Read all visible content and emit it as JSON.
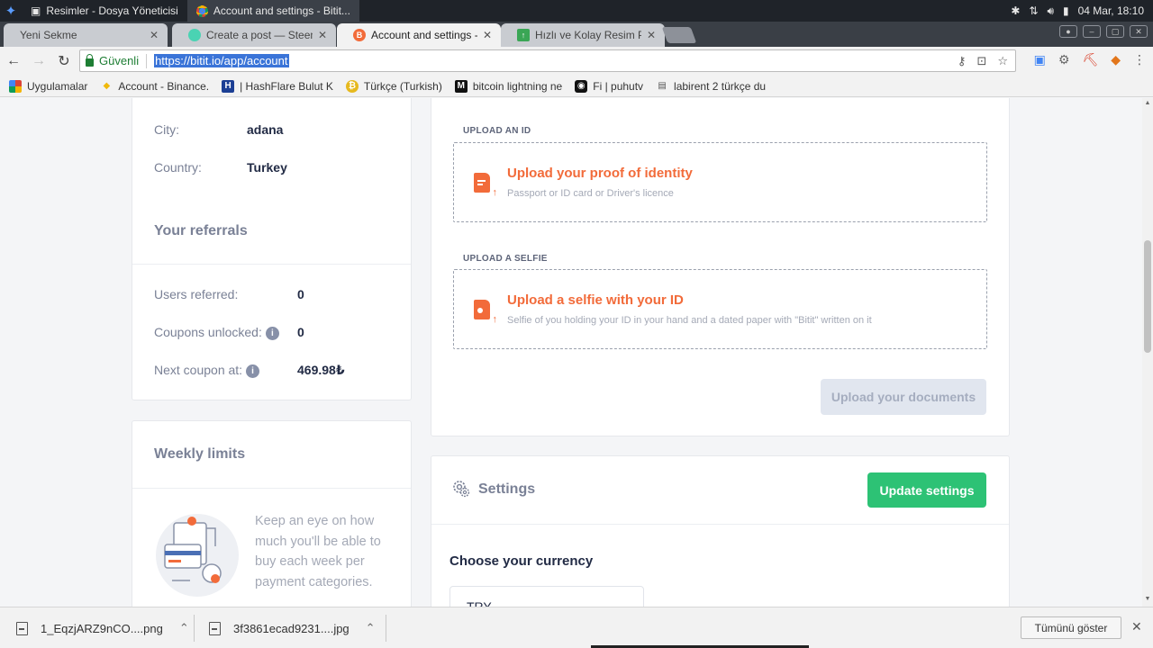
{
  "os": {
    "tasks": [
      {
        "label": "Resimler - Dosya Yöneticisi"
      },
      {
        "label": "Account and settings - Bitit..."
      }
    ],
    "clock": "04 Mar, 18:10"
  },
  "browser": {
    "tabs": [
      {
        "title": "Yeni Sekme"
      },
      {
        "title": "Create a post — Steem"
      },
      {
        "title": "Account and settings -"
      },
      {
        "title": "Hızlı ve Kolay Resim Pa"
      }
    ],
    "secure_label": "Güvenli",
    "url": "https://bitit.io/app/account",
    "bookmarks": [
      {
        "label": "Uygulamalar"
      },
      {
        "label": "Account - Binance."
      },
      {
        "label": "| HashFlare Bulut K"
      },
      {
        "label": "Türkçe (Turkish)"
      },
      {
        "label": "bitcoin lightning ne"
      },
      {
        "label": "Fi | puhutv"
      },
      {
        "label": "labirent 2 türkçe du"
      }
    ]
  },
  "profile": {
    "city_label": "City:",
    "city_value": "adana",
    "country_label": "Country:",
    "country_value": "Turkey"
  },
  "referrals": {
    "title": "Your referrals",
    "users_referred_label": "Users referred:",
    "users_referred_value": "0",
    "coupons_unlocked_label": "Coupons unlocked:",
    "coupons_unlocked_value": "0",
    "next_coupon_label": "Next coupon at:",
    "next_coupon_value": "469.98₺"
  },
  "weekly_limits": {
    "title": "Weekly limits",
    "text": "Keep an eye on how much you'll be able to buy each week per payment categories."
  },
  "upload": {
    "id_label": "UPLOAD AN ID",
    "id_title": "Upload your proof of identity",
    "id_sub": "Passport or ID card or Driver's licence",
    "selfie_label": "UPLOAD A SELFIE",
    "selfie_title": "Upload a selfie with your ID",
    "selfie_sub": "Selfie of you holding your ID in your hand and a dated paper with \"Bitit\" written on it",
    "submit_label": "Upload your documents"
  },
  "settings": {
    "title": "Settings",
    "update_label": "Update settings",
    "currency_title": "Choose your currency",
    "currency_value": "TRY"
  },
  "downloads": {
    "items": [
      {
        "name": "1_EqzjARZ9nCO....png"
      },
      {
        "name": "3f3861ecad9231....jpg"
      }
    ],
    "show_all": "Tümünü göster"
  },
  "colors": {
    "accent_orange": "#f26b3a",
    "accent_green": "#2dc275",
    "muted_text": "#7a8196"
  }
}
